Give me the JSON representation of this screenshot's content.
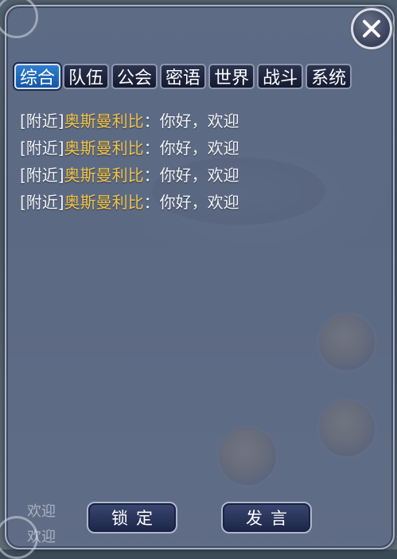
{
  "tabs": [
    {
      "label": "综合",
      "active": true
    },
    {
      "label": "队伍",
      "active": false
    },
    {
      "label": "公会",
      "active": false
    },
    {
      "label": "密语",
      "active": false
    },
    {
      "label": "世界",
      "active": false
    },
    {
      "label": "战斗",
      "active": false
    },
    {
      "label": "系统",
      "active": false
    }
  ],
  "messages": [
    {
      "channel": "[附近]",
      "sender": "奥斯曼利比",
      "separator": "：",
      "text": "你好，欢迎"
    },
    {
      "channel": "[附近]",
      "sender": "奥斯曼利比",
      "separator": "：",
      "text": "你好，欢迎"
    },
    {
      "channel": "[附近]",
      "sender": "奥斯曼利比",
      "separator": "：",
      "text": "你好，欢迎"
    },
    {
      "channel": "[附近]",
      "sender": "奥斯曼利比",
      "separator": "：",
      "text": "你好，欢迎"
    }
  ],
  "buttons": {
    "lock_label": "锁定",
    "send_label": "发言"
  },
  "background_hints": [
    "欢迎",
    "欢迎"
  ],
  "icons": {
    "close": "close-icon"
  },
  "colors": {
    "active_tab": "#1f6dbd",
    "sender_name": "#f0c54e",
    "message_text": "#f2f4f8"
  }
}
